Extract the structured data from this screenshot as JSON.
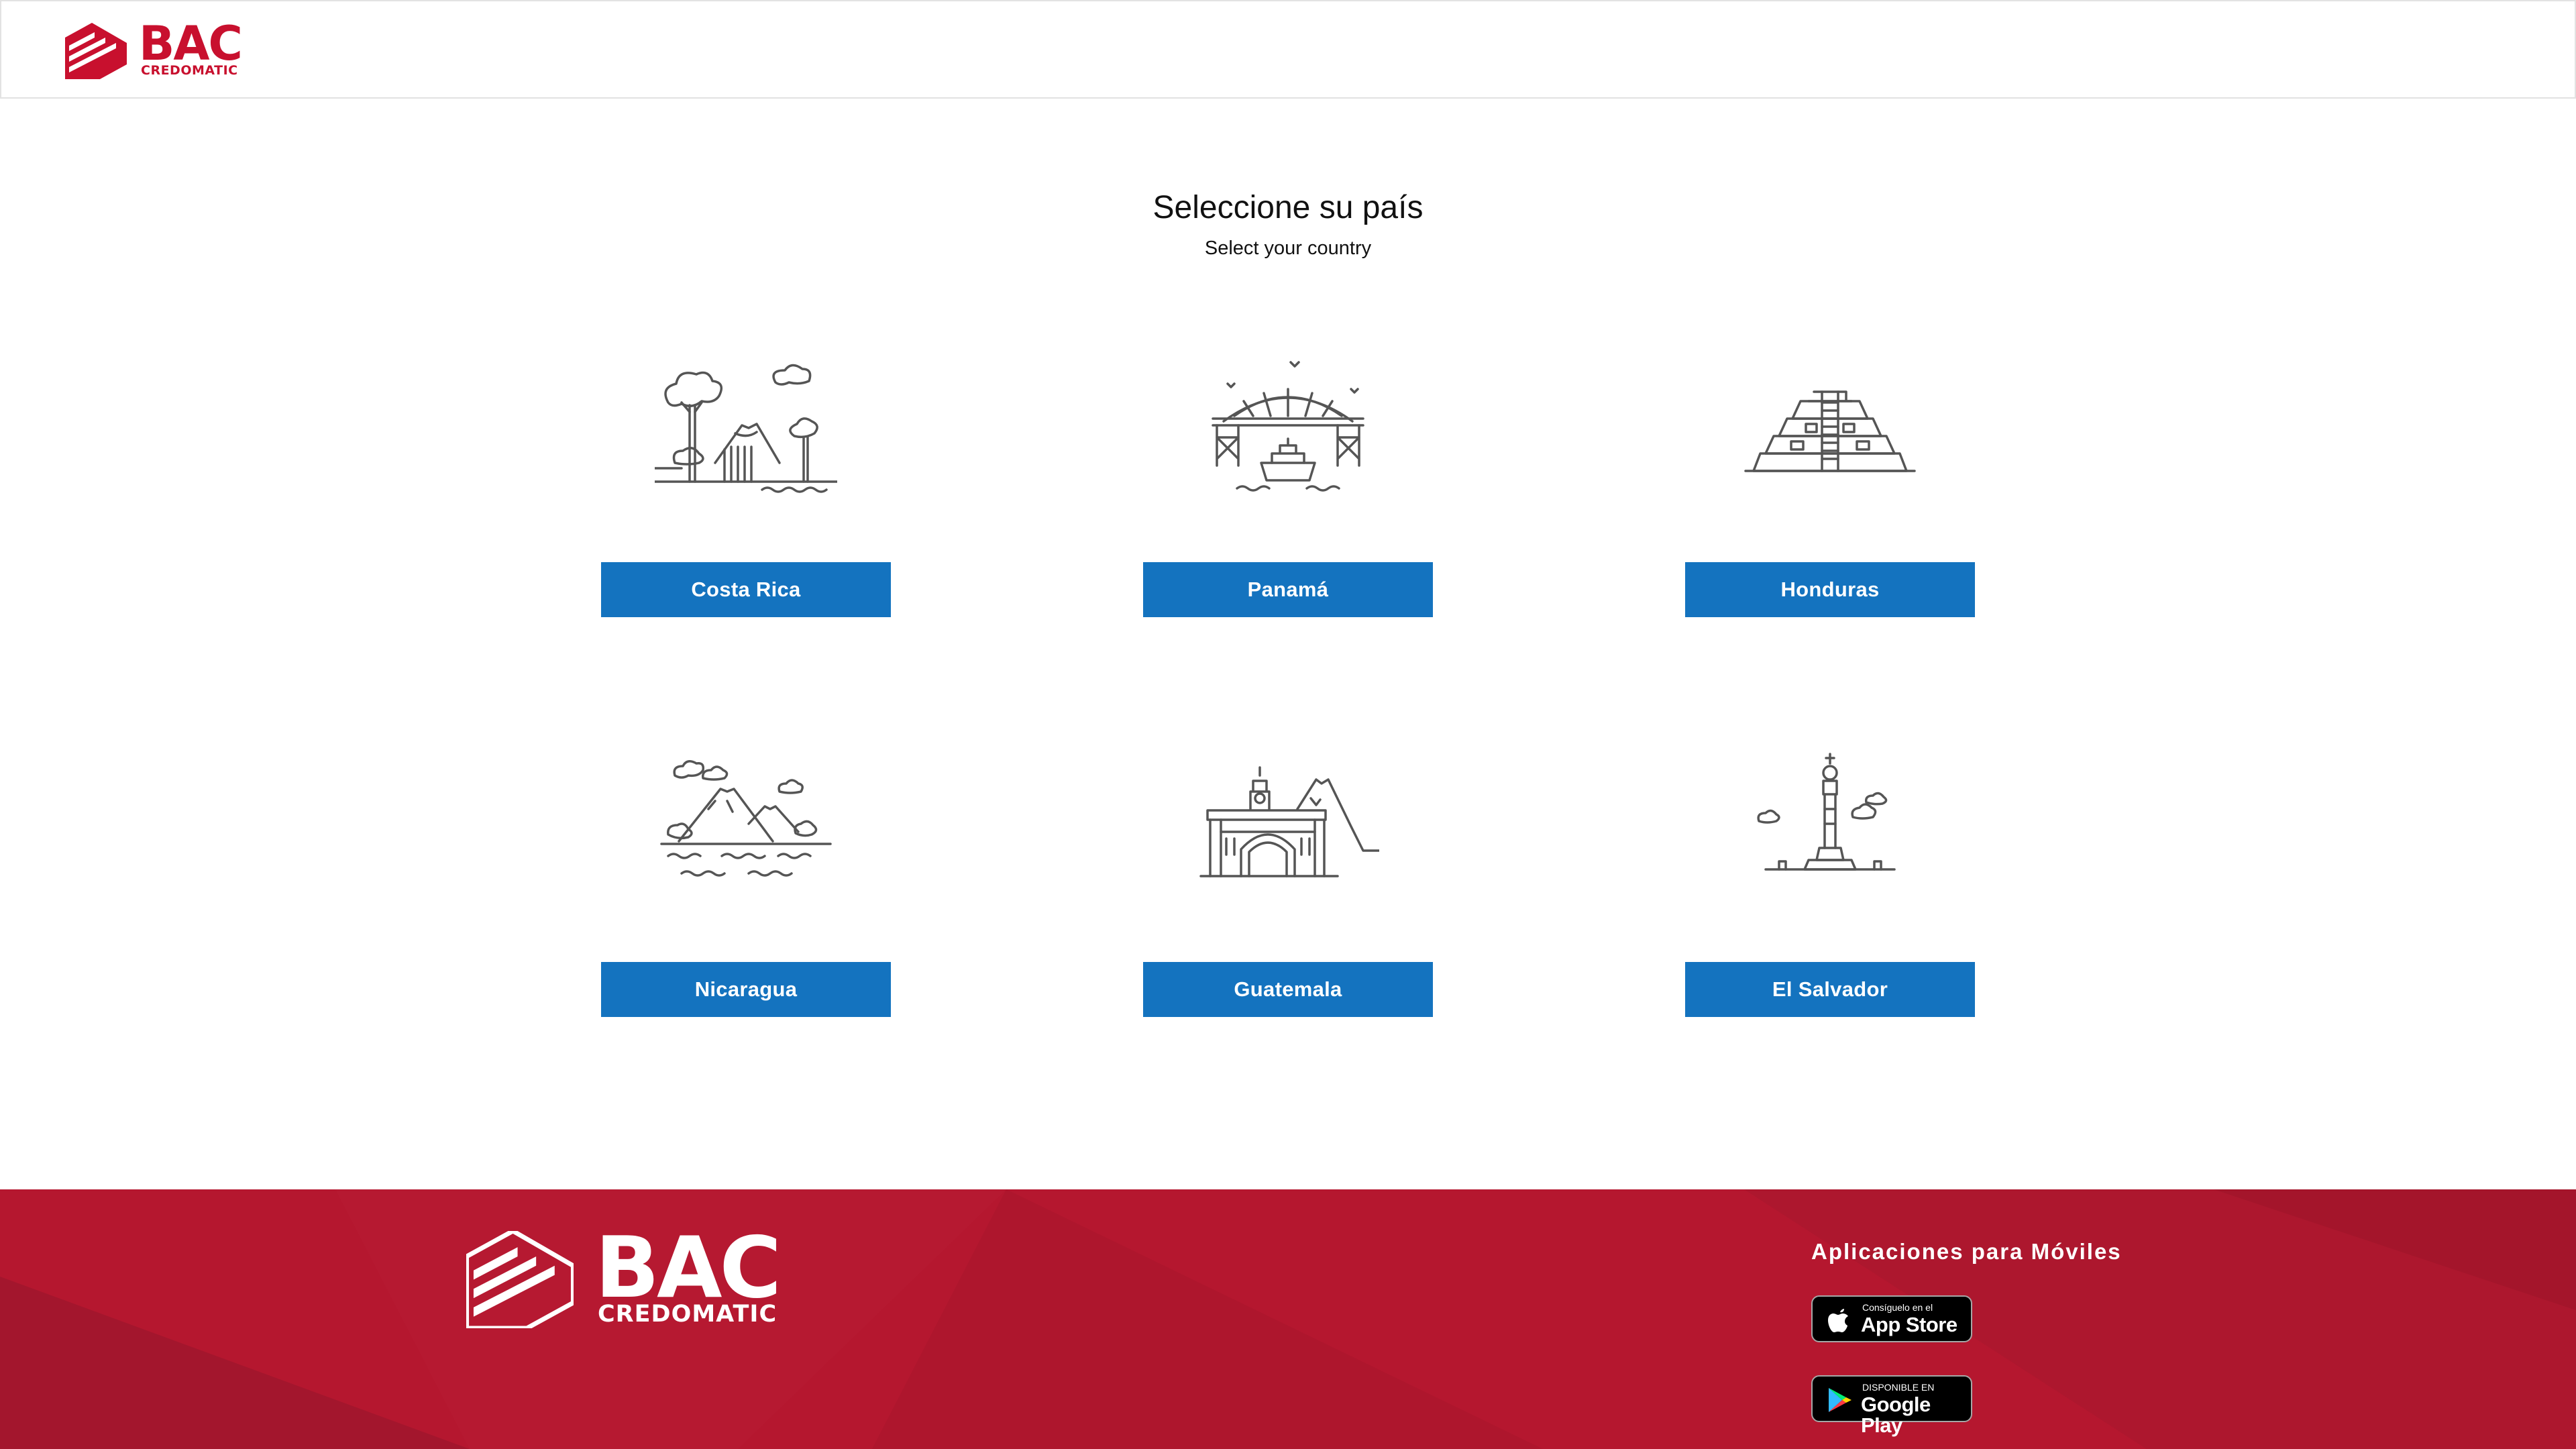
{
  "header": {
    "logo_text": "BAC",
    "logo_subtext": "CREDOMATIC"
  },
  "main": {
    "title": "Seleccione su país",
    "subtitle": "Select your country",
    "countries": [
      {
        "label": "Costa Rica",
        "icon": "costa-rica-landscape-icon"
      },
      {
        "label": "Panamá",
        "icon": "panama-canal-bridge-icon"
      },
      {
        "label": "Honduras",
        "icon": "honduras-pyramid-icon"
      },
      {
        "label": "Nicaragua",
        "icon": "nicaragua-volcanoes-icon"
      },
      {
        "label": "Guatemala",
        "icon": "guatemala-arch-icon"
      },
      {
        "label": "El Salvador",
        "icon": "el-salvador-monument-icon"
      }
    ]
  },
  "footer": {
    "logo_text": "BAC",
    "logo_subtext": "CREDOMATIC",
    "apps_title": "Aplicaciones para Móviles",
    "app_store": {
      "small": "Consíguelo en el",
      "big": "App Store"
    },
    "google_play": {
      "small": "DISPONIBLE EN",
      "big": "Google Play"
    }
  },
  "colors": {
    "brand_red": "#c8102e",
    "button_blue": "#1473bf",
    "footer_red": "#b5172f",
    "icon_gray": "#555555"
  }
}
